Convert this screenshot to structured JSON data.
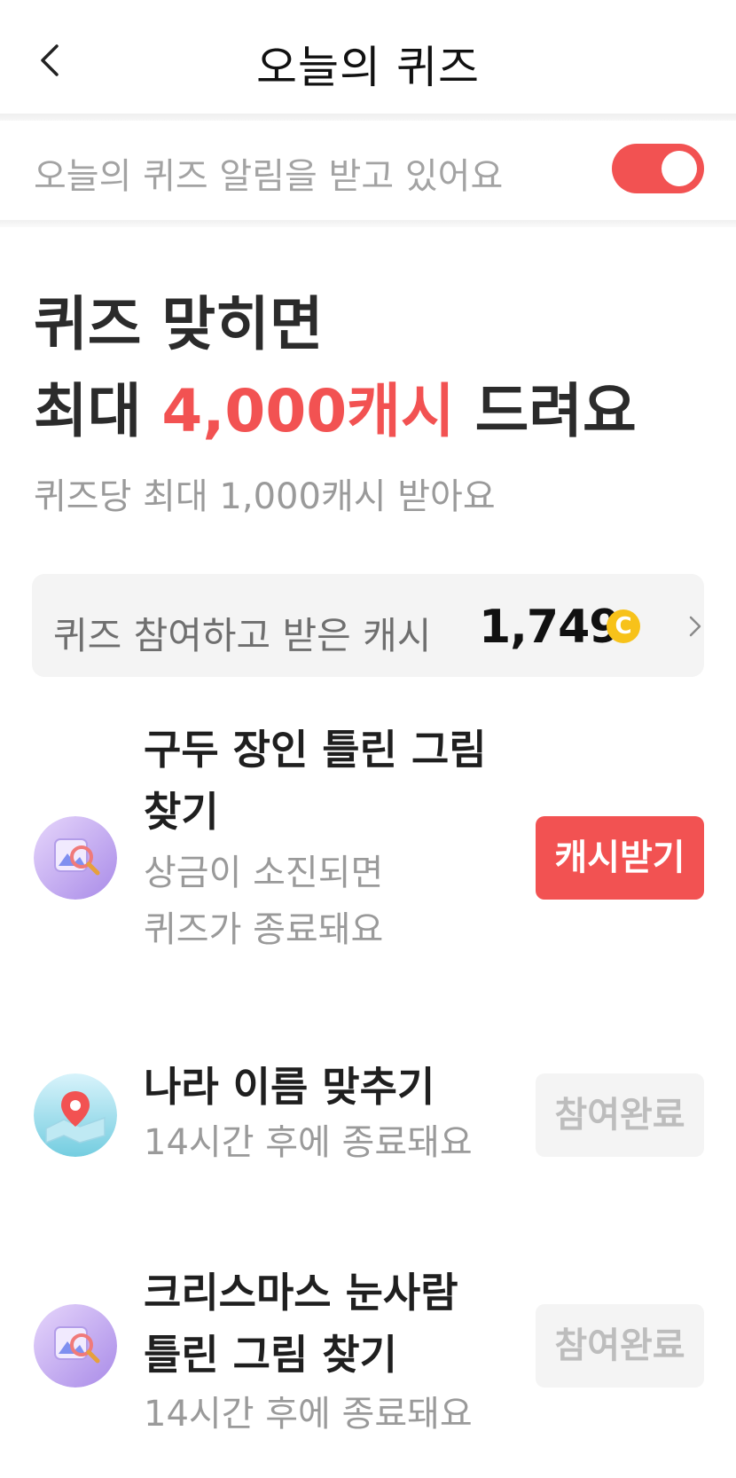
{
  "header": {
    "title": "오늘의 퀴즈"
  },
  "notification": {
    "text": "오늘의 퀴즈 알림을 받고 있어요",
    "enabled": true
  },
  "hero": {
    "line1": "퀴즈 맞히면",
    "line2_prefix": "최대 ",
    "line2_accent": "4,000캐시",
    "line2_suffix": " 드려요",
    "subtitle": "퀴즈당 최대 1,000캐시 받아요"
  },
  "cash_summary": {
    "label": "퀴즈 참여하고 받은 캐시",
    "value": "1,749",
    "coin_symbol": "C"
  },
  "quizzes": [
    {
      "title_line1": "구두 장인 틀린 그림",
      "title_line2": "찾기",
      "sub_line1": "상금이 소진되면",
      "sub_line2": "퀴즈가 종료돼요",
      "button": "캐시받기",
      "icon": "magnifier-picture-icon"
    },
    {
      "title_line1": "나라 이름 맞추기",
      "sub_line1": "14시간 후에 종료돼요",
      "button": "참여완료",
      "icon": "map-pin-icon"
    },
    {
      "title_line1": "크리스마스 눈사람",
      "title_line2": "틀린 그림 찾기",
      "sub_line1": "14시간 후에 종료돼요",
      "button": "참여완료",
      "icon": "magnifier-picture-icon"
    }
  ],
  "colors": {
    "accent": "#f25252",
    "coin": "#f7c21a"
  }
}
